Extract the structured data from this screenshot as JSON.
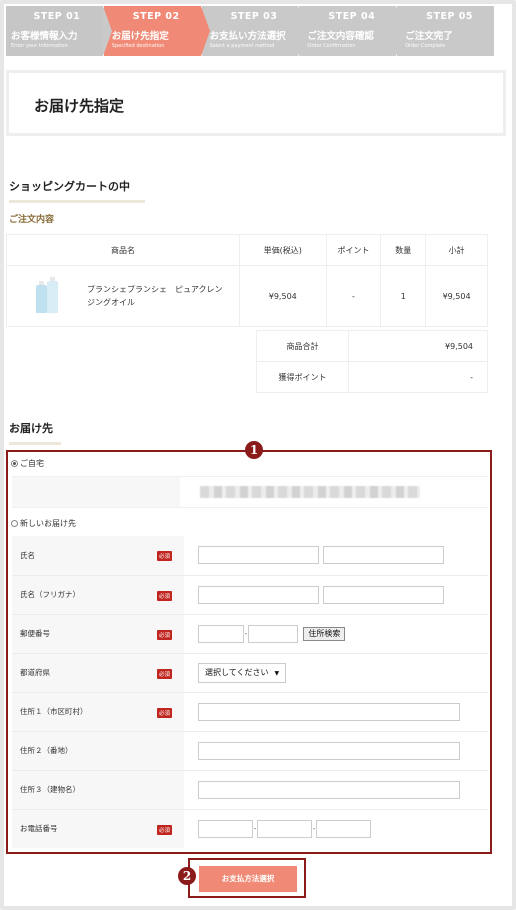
{
  "steps": [
    {
      "num": "STEP 01",
      "jp": "お客様情報入力",
      "en": "Enter your Information"
    },
    {
      "num": "STEP 02",
      "jp": "お届け先指定",
      "en": "Specified destination"
    },
    {
      "num": "STEP 03",
      "jp": "お支払い方法選択",
      "en": "Select a payment method"
    },
    {
      "num": "STEP 04",
      "jp": "ご注文内容確認",
      "en": "Order Confirmation"
    },
    {
      "num": "STEP 05",
      "jp": "ご注文完了",
      "en": "Order Complete"
    }
  ],
  "page_title": "お届け先指定",
  "cart": {
    "heading": "ショッピングカートの中",
    "subheading": "ご注文内容",
    "columns": [
      "商品名",
      "単価(税込)",
      "ポイント",
      "数量",
      "小計"
    ],
    "item": {
      "name": "ブランシェブランシェ　ピュアクレンジングオイル",
      "price": "¥9,504",
      "points": "-",
      "qty": "1",
      "subtotal": "¥9,504"
    },
    "summary": {
      "total_label": "商品合計",
      "total_value": "¥9,504",
      "points_label": "獲得ポイント",
      "points_value": "-"
    }
  },
  "delivery": {
    "heading": "お届け先",
    "home_label": "ご自宅",
    "new_label": "新しいお届け先",
    "required_badge": "必須",
    "fields": {
      "name": "氏名",
      "kana": "氏名（フリガナ）",
      "zip": "郵便番号",
      "pref": "都道府県",
      "addr1": "住所１（市区町村）",
      "addr2": "住所２（番地）",
      "addr3": "住所３（建物名）",
      "tel": "お電話番号"
    },
    "zip_search_button": "住所検索",
    "pref_select": "選択してください"
  },
  "submit_button": "お支払方法選択",
  "callouts": {
    "one": "1",
    "two": "2"
  },
  "colors": {
    "accent": "#f08a76",
    "inactive_step": "#c9c9c9",
    "callout": "#8b1a1a",
    "required": "#c0261f"
  }
}
